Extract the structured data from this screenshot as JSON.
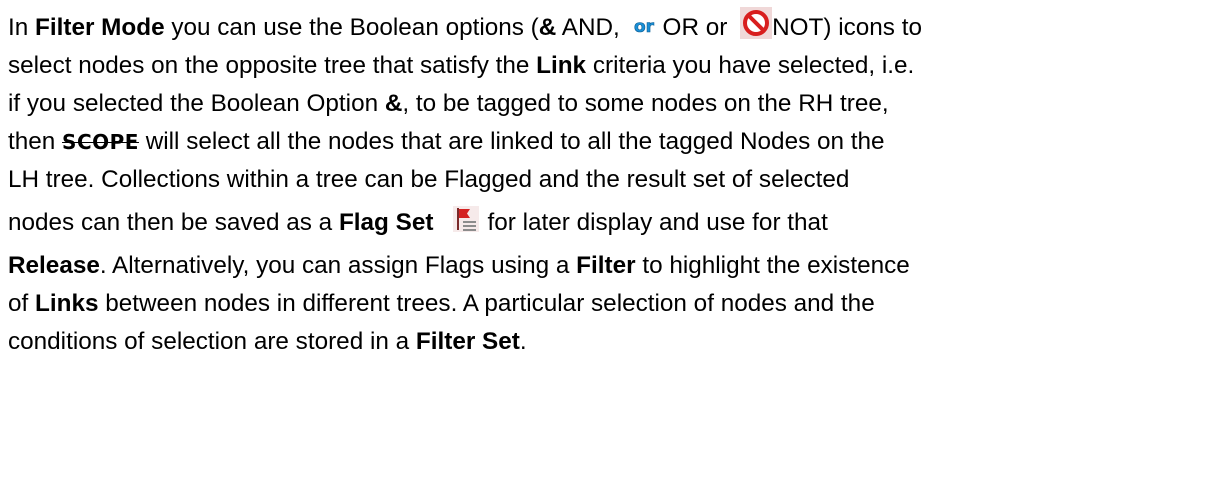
{
  "paragraph": {
    "l1_t1": "In ",
    "l1_b1": "Filter Mode",
    "l1_t2": " you can use the Boolean options (",
    "l1_b2": "&",
    "l1_t3": " AND, ",
    "l1_t4": "OR or ",
    "l1_t5": "NOT) icons to",
    "l2_t1": "select nodes on the opposite tree that satisfy the ",
    "l2_b1": "Link",
    "l2_t2": " criteria you have selected, i.e.",
    "l3_t1": "if you selected the Boolean Option ",
    "l3_b1": "&",
    "l3_t2": ", to be tagged to some nodes on the RH tree,",
    "l4_t1": "then ",
    "l4_scope": "SCOPE",
    "l4_t2": " will select all the nodes that are linked to all the tagged Nodes on the",
    "l5_t1": "LH tree.  Collections within a tree can be Flagged and the result set of selected",
    "l6_t1": "nodes can then be saved as a ",
    "l6_b1": "Flag Set",
    "l6_t2": "for later display and use for that",
    "l7_b1": "Release",
    "l7_t1": ".  Alternatively, you can assign Flags using a ",
    "l7_b2": "Filter",
    "l7_t2": " to highlight the existence",
    "l8_t1": "of ",
    "l8_b1": "Links",
    "l8_t2": " between nodes in different trees.  A particular selection of nodes and the",
    "l9_t1": "conditions of selection are stored in a ",
    "l9_b1": "Filter Set",
    "l9_t2": "."
  },
  "icons": {
    "or_icon": "or-icon",
    "not_icon": "not-icon",
    "flag_set_icon": "flag-set-icon"
  },
  "colors": {
    "or_icon_text": "#1a8fd6",
    "not_icon_ring": "#d81e1e",
    "not_icon_background": "#f0d8d8",
    "flag_red": "#d42222",
    "text": "#000000"
  }
}
